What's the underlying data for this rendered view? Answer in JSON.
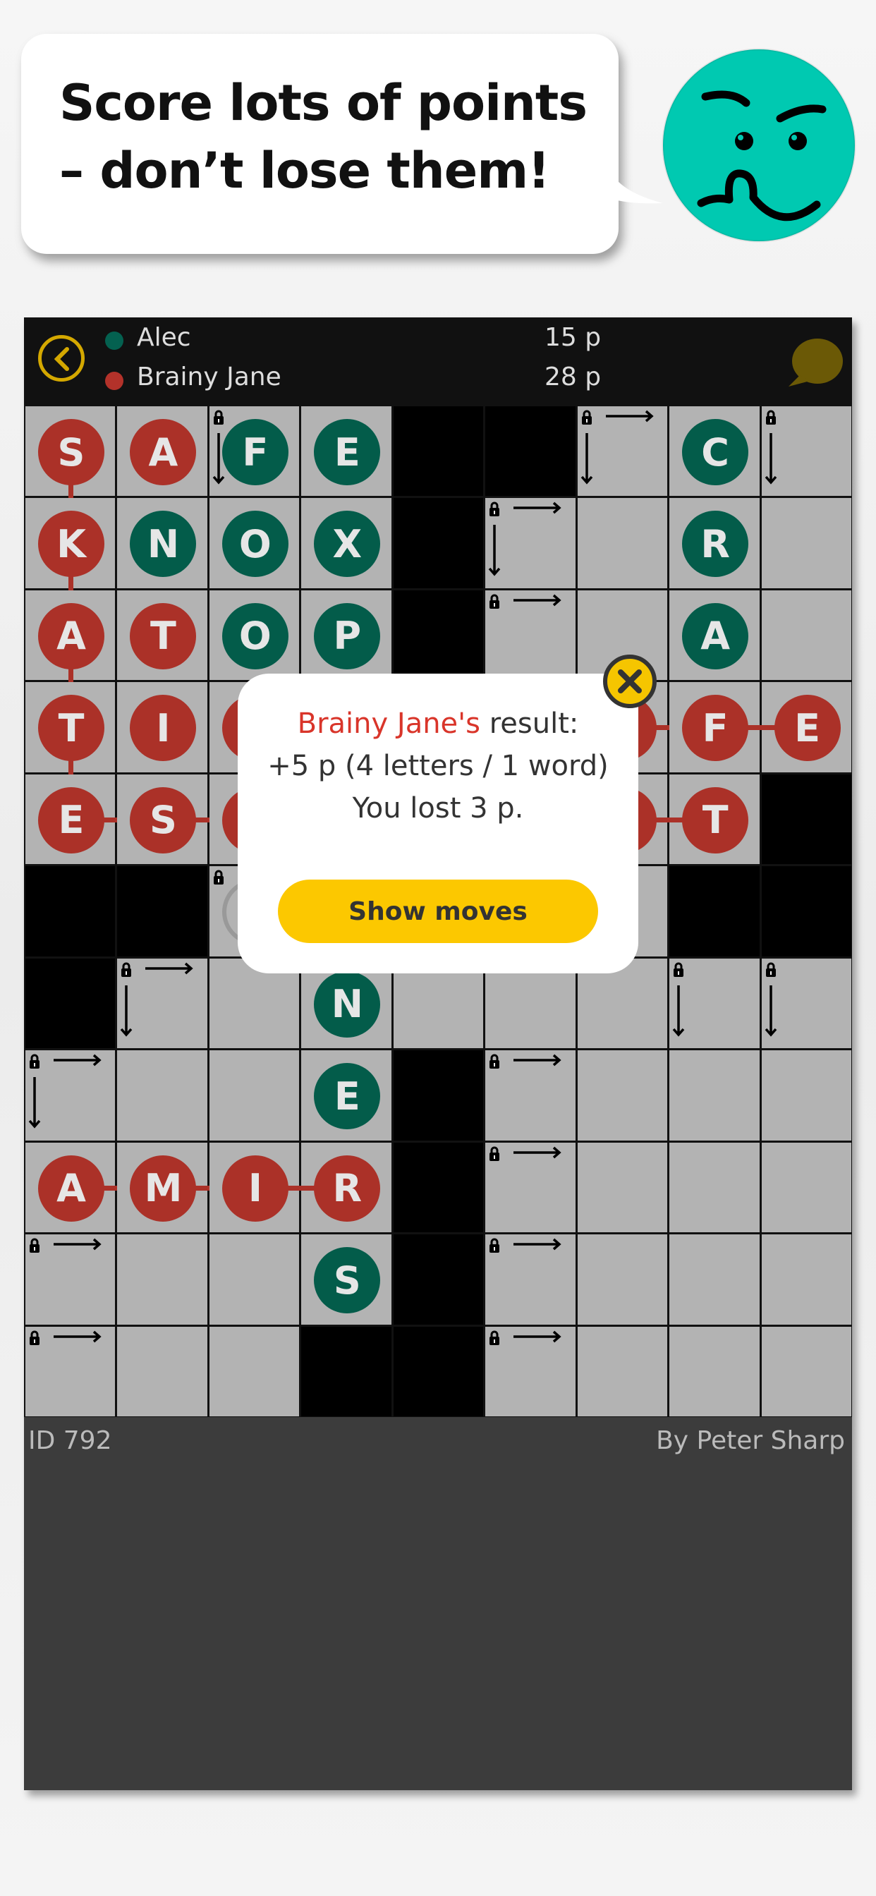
{
  "promo": {
    "line1": "Score lots of points",
    "line2": "– don’t lose them!",
    "face_color": "#00c9b1"
  },
  "header": {
    "players": [
      {
        "name": "Alec",
        "score": "15 p",
        "color": "#046150"
      },
      {
        "name": "Brainy Jane",
        "score": "28 p",
        "color": "#b3322a"
      }
    ],
    "back_icon": "chevron-left-icon",
    "chat_icon": "speech-bubble-icon"
  },
  "colors": {
    "red": "#ab3128",
    "green": "#035c4a",
    "cell": "#b3b3b3",
    "accent": "#fcc800"
  },
  "grid": [
    [
      {
        "letter": "S",
        "player": "red",
        "join": [
          "down"
        ]
      },
      {
        "letter": "A",
        "player": "red"
      },
      {
        "letter": "F",
        "player": "green",
        "lock": [
          "down"
        ]
      },
      {
        "letter": "E",
        "player": "green"
      },
      {
        "black": true
      },
      {
        "black": true
      },
      {
        "lock": [
          "right",
          "down"
        ]
      },
      {
        "letter": "C",
        "player": "green"
      },
      {
        "lock": [
          "down"
        ]
      }
    ],
    [
      {
        "letter": "K",
        "player": "red",
        "join": [
          "down"
        ]
      },
      {
        "letter": "N",
        "player": "green"
      },
      {
        "letter": "O",
        "player": "green"
      },
      {
        "letter": "X",
        "player": "green"
      },
      {
        "black": true
      },
      {
        "lock": [
          "right",
          "down"
        ]
      },
      {},
      {
        "letter": "R",
        "player": "green"
      },
      {}
    ],
    [
      {
        "letter": "A",
        "player": "red",
        "join": [
          "down"
        ]
      },
      {
        "letter": "T",
        "player": "red"
      },
      {
        "letter": "O",
        "player": "green"
      },
      {
        "letter": "P",
        "player": "green"
      },
      {
        "black": true
      },
      {
        "lock": [
          "right"
        ]
      },
      {},
      {
        "letter": "A",
        "player": "green"
      },
      {}
    ],
    [
      {
        "letter": "T",
        "player": "red",
        "join": [
          "down"
        ]
      },
      {
        "letter": "I",
        "player": "red"
      },
      {
        "letter": "",
        "player": "red"
      },
      {},
      {},
      {},
      {
        "letter": "",
        "player": "red",
        "join": [
          "right"
        ]
      },
      {
        "letter": "F",
        "player": "red",
        "join": [
          "right"
        ]
      },
      {
        "letter": "E",
        "player": "red"
      }
    ],
    [
      {
        "letter": "E",
        "player": "red",
        "join": [
          "right"
        ]
      },
      {
        "letter": "S",
        "player": "red",
        "join": [
          "right"
        ]
      },
      {
        "letter": "",
        "player": "red",
        "join": [
          "right"
        ]
      },
      {},
      {},
      {},
      {
        "letter": "",
        "player": "red",
        "join": [
          "right"
        ]
      },
      {
        "letter": "T",
        "player": "red"
      },
      {
        "black": true
      }
    ],
    [
      {
        "black": true
      },
      {
        "black": true
      },
      {
        "lock": [],
        "pending": true
      },
      {},
      {},
      {},
      {},
      {
        "black": true
      },
      {
        "black": true
      }
    ],
    [
      {
        "black": true
      },
      {
        "lock": [
          "right",
          "down"
        ]
      },
      {},
      {
        "letter": "N",
        "player": "green"
      },
      {},
      {},
      {},
      {
        "lock": [
          "down"
        ]
      },
      {
        "lock": [
          "down"
        ]
      }
    ],
    [
      {
        "lock": [
          "right",
          "down"
        ]
      },
      {},
      {},
      {
        "letter": "E",
        "player": "green"
      },
      {
        "black": true
      },
      {
        "lock": [
          "right"
        ]
      },
      {},
      {},
      {}
    ],
    [
      {
        "letter": "A",
        "player": "red",
        "join": [
          "right"
        ]
      },
      {
        "letter": "M",
        "player": "red",
        "join": [
          "right"
        ]
      },
      {
        "letter": "I",
        "player": "red",
        "join": [
          "right"
        ]
      },
      {
        "letter": "R",
        "player": "red"
      },
      {
        "black": true
      },
      {
        "lock": [
          "right"
        ]
      },
      {},
      {},
      {}
    ],
    [
      {
        "lock": [
          "right"
        ]
      },
      {},
      {},
      {
        "letter": "S",
        "player": "green"
      },
      {
        "black": true
      },
      {
        "lock": [
          "right"
        ]
      },
      {},
      {},
      {}
    ],
    [
      {
        "lock": [
          "right"
        ]
      },
      {},
      {},
      {
        "black": true
      },
      {
        "black": true
      },
      {
        "lock": [
          "right"
        ]
      },
      {},
      {},
      {}
    ]
  ],
  "footer": {
    "id": "ID 792",
    "author": "By Peter Sharp"
  },
  "popup": {
    "player": "Brainy Jane's",
    "result_suffix": " result:",
    "points": "+5 p (4 letters / 1 word)",
    "lost": "You lost 3 p.",
    "button": "Show moves"
  }
}
